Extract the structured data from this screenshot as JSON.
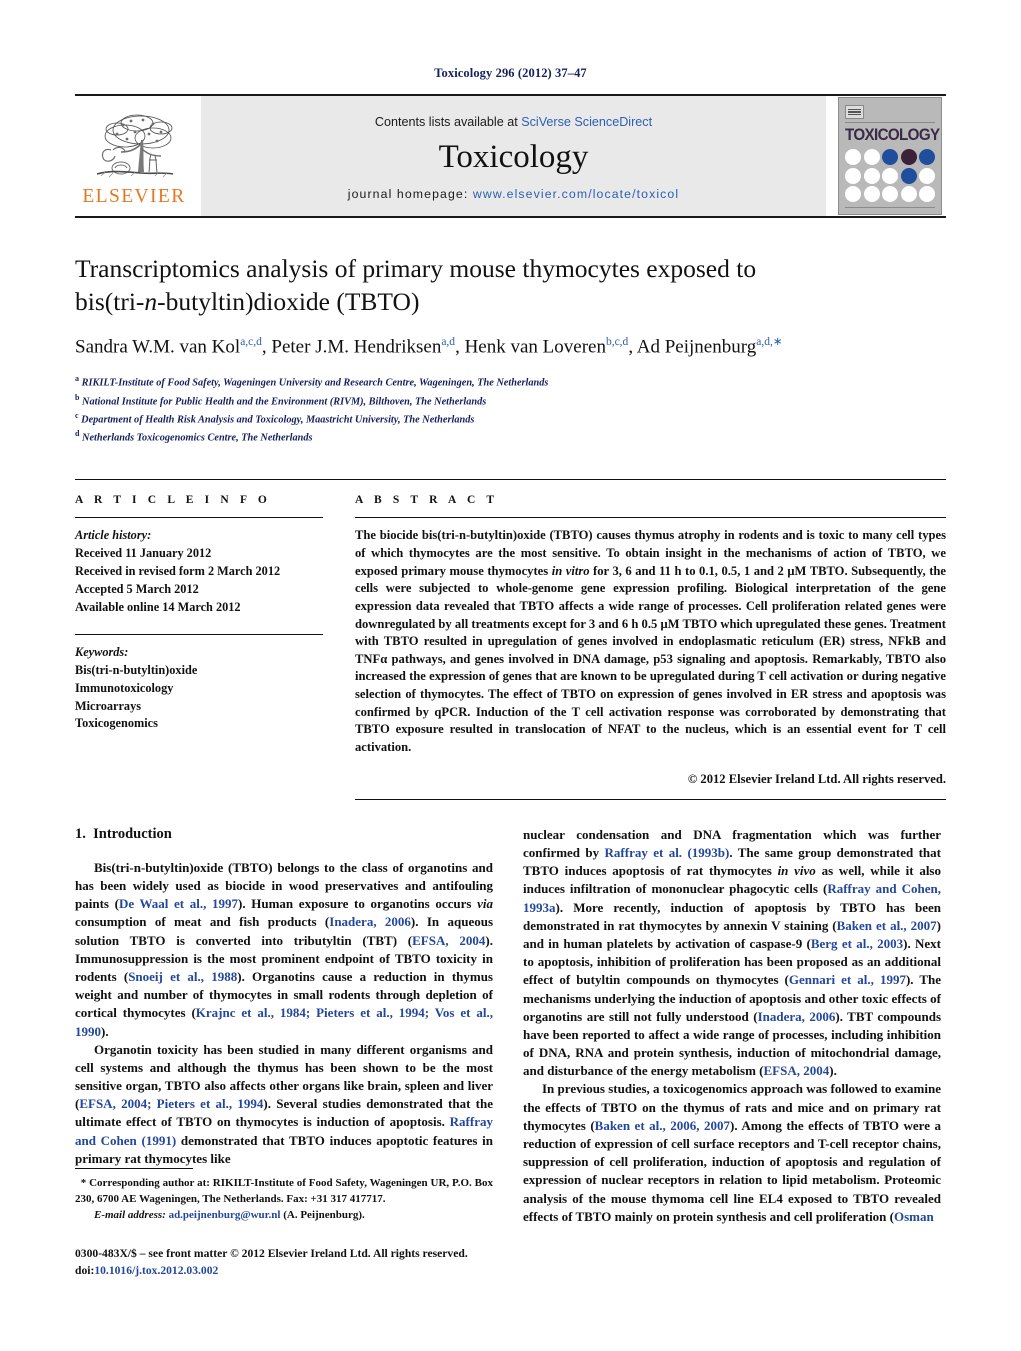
{
  "running_head": "Toxicology 296 (2012) 37–47",
  "masthead": {
    "publisher_name": "ELSEVIER",
    "contents_prefix": "Contents lists available at ",
    "contents_link": "SciVerse ScienceDirect",
    "journal_name": "Toxicology",
    "homepage_prefix": "journal homepage: ",
    "homepage_url": "www.elsevier.com/locate/toxicol",
    "cover_title": "TOXICOLOGY",
    "cover_dots": [
      [
        "white",
        "white",
        "blue",
        "plum",
        "blue"
      ],
      [
        "white",
        "white",
        "white",
        "blue",
        "white"
      ],
      [
        "white",
        "white",
        "white",
        "white",
        "white"
      ]
    ]
  },
  "article": {
    "title_line1": "Transcriptomics analysis of primary mouse thymocytes exposed to",
    "title_line2_a": "bis(tri-",
    "title_line2_italic": "n",
    "title_line2_b": "-butyltin)dioxide (TBTO)",
    "authors": [
      {
        "name": "Sandra W.M. van Kol",
        "sup": "a,c,d",
        "sep": ", "
      },
      {
        "name": "Peter J.M. Hendriksen",
        "sup": "a,d",
        "sep": ", "
      },
      {
        "name": "Henk van Loveren",
        "sup": "b,c,d",
        "sep": ", "
      },
      {
        "name": "Ad Peijnenburg",
        "sup": "a,d,",
        "sep": ""
      }
    ],
    "affiliations": [
      {
        "mark": "a",
        "text": "RIKILT-Institute of Food Safety, Wageningen University and Research Centre, Wageningen, The Netherlands"
      },
      {
        "mark": "b",
        "text": "National Institute for Public Health and the Environment (RIVM), Bilthoven, The Netherlands"
      },
      {
        "mark": "c",
        "text": "Department of Health Risk Analysis and Toxicology, Maastricht University, The Netherlands"
      },
      {
        "mark": "d",
        "text": "Netherlands Toxicogenomics Centre, The Netherlands"
      }
    ]
  },
  "article_info": {
    "heading": "A R T I C L E   I N F O",
    "history_label": "Article history:",
    "history": [
      "Received 11 January 2012",
      "Received in revised form 2 March 2012",
      "Accepted 5 March 2012",
      "Available online 14 March 2012"
    ],
    "keywords_label": "Keywords:",
    "keywords": [
      "Bis(tri-n-butyltin)oxide",
      "Immunotoxicology",
      "Microarrays",
      "Toxicogenomics"
    ]
  },
  "abstract": {
    "heading": "A B S T R A C T",
    "part1": "The biocide bis(tri-n-butyltin)oxide (TBTO) causes thymus atrophy in rodents and is toxic to many cell types of which thymocytes are the most sensitive. To obtain insight in the mechanisms of action of TBTO, we exposed primary mouse thymocytes ",
    "italic1": "in vitro",
    "part2": " for 3, 6 and 11 h to 0.1, 0.5, 1 and 2 μM TBTO. Subsequently, the cells were subjected to whole-genome gene expression profiling. Biological interpretation of the gene expression data revealed that TBTO affects a wide range of processes. Cell proliferation related genes were downregulated by all treatments except for 3 and 6 h 0.5 μM TBTO which upregulated these genes. Treatment with TBTO resulted in upregulation of genes involved in endoplasmatic reticulum (ER) stress, NFkB and TNFα pathways, and genes involved in DNA damage, p53 signaling and apoptosis. Remarkably, TBTO also increased the expression of genes that are known to be upregulated during T cell activation or during negative selection of thymocytes. The effect of TBTO on expression of genes involved in ER stress and apoptosis was confirmed by qPCR. Induction of the T cell activation response was corroborated by demonstrating that TBTO exposure resulted in translocation of NFAT to the nucleus, which is an essential event for T cell activation.",
    "copyright": "© 2012 Elsevier Ireland Ltd. All rights reserved."
  },
  "introduction": {
    "section_number": "1.",
    "section_title": "Introduction",
    "left_para1": {
      "t1": "Bis(tri-n-butyltin)oxide (TBTO) belongs to the class of organotins and has been widely used as biocide in wood preservatives and antifouling paints (",
      "r1": "De Waal et al., 1997",
      "t2": "). Human exposure to organotins occurs ",
      "i1": "via",
      "t3": " consumption of meat and fish products (",
      "r2": "Inadera, 2006",
      "t4": "). In aqueous solution TBTO is converted into tributyltin (TBT) (",
      "r3": "EFSA, 2004",
      "t5": "). Immunosuppression is the most prominent endpoint of TBTO toxicity in rodents (",
      "r4": "Snoeij et al., 1988",
      "t6": "). Organotins cause a reduction in thymus weight and number of thymocytes in small rodents through depletion of cortical thymocytes (",
      "r5": "Krajnc et al., 1984; Pieters et al., 1994; Vos et al., 1990",
      "t7": ")."
    },
    "left_para2": {
      "t1": "Organotin toxicity has been studied in many different organisms and cell systems and although the thymus has been shown to be the most sensitive organ, TBTO also affects other organs like brain, spleen and liver (",
      "r1": "EFSA, 2004; Pieters et al., 1994",
      "t2": "). Several studies demonstrated that the ultimate effect of TBTO on thymocytes is induction of apoptosis. ",
      "r2": "Raffray and Cohen (1991)",
      "t3": " demonstrated that TBTO induces apoptotic features in primary rat thymocytes like"
    },
    "right_para1": {
      "t1": "nuclear condensation and DNA fragmentation which was further confirmed by ",
      "r1": "Raffray et al. (1993b)",
      "t2": ". The same group demonstrated that TBTO induces apoptosis of rat thymocytes ",
      "i1": "in vivo",
      "t3": " as well, while it also induces infiltration of mononuclear phagocytic cells (",
      "r2": "Raffray and Cohen, 1993a",
      "t4": "). More recently, induction of apoptosis by TBTO has been demonstrated in rat thymocytes by annexin V staining (",
      "r3": "Baken et al., 2007",
      "t5": ") and in human platelets by activation of caspase-9 (",
      "r4": "Berg et al., 2003",
      "t6": "). Next to apoptosis, inhibition of proliferation has been proposed as an additional effect of butyltin compounds on thymocytes (",
      "r5": "Gennari et al., 1997",
      "t7": "). The mechanisms underlying the induction of apoptosis and other toxic effects of organotins are still not fully understood (",
      "r6": "Inadera, 2006",
      "t8": "). TBT compounds have been reported to affect a wide range of processes, including inhibition of DNA, RNA and protein synthesis, induction of mitochondrial damage, and disturbance of the energy metabolism (",
      "r7": "EFSA, 2004",
      "t9": ")."
    },
    "right_para2": {
      "t1": "In previous studies, a toxicogenomics approach was followed to examine the effects of TBTO on the thymus of rats and mice and on primary rat thymocytes (",
      "r1": "Baken et al., 2006, 2007",
      "t2": "). Among the effects of TBTO were a reduction of expression of cell surface receptors and T-cell receptor chains, suppression of cell proliferation, induction of apoptosis and regulation of expression of nuclear receptors in relation to lipid metabolism. Proteomic analysis of the mouse thymoma cell line EL4 exposed to TBTO revealed effects of TBTO mainly on protein synthesis and cell proliferation (",
      "r2": "Osman"
    }
  },
  "footnote": {
    "star": "*",
    "corresponding": " Corresponding author at: RIKILT-Institute of Food Safety, Wageningen UR, P.O. Box 230, 6700 AE Wageningen, The Netherlands. Fax: +31 317 417717.",
    "email_label": "E-mail address:",
    "email": "ad.peijnenburg@wur.nl",
    "email_owner": " (A. Peijnenburg).",
    "issn_line": "0300-483X/$ – see front matter © 2012 Elsevier Ireland Ltd. All rights reserved.",
    "doi_label": "doi:",
    "doi": "10.1016/j.tox.2012.03.002"
  },
  "colors": {
    "link": "#23479b",
    "navy": "#16205e",
    "elsevier_orange": "#e87722",
    "cover_blue": "#1f4e9c",
    "cover_plum": "#3b2238"
  }
}
